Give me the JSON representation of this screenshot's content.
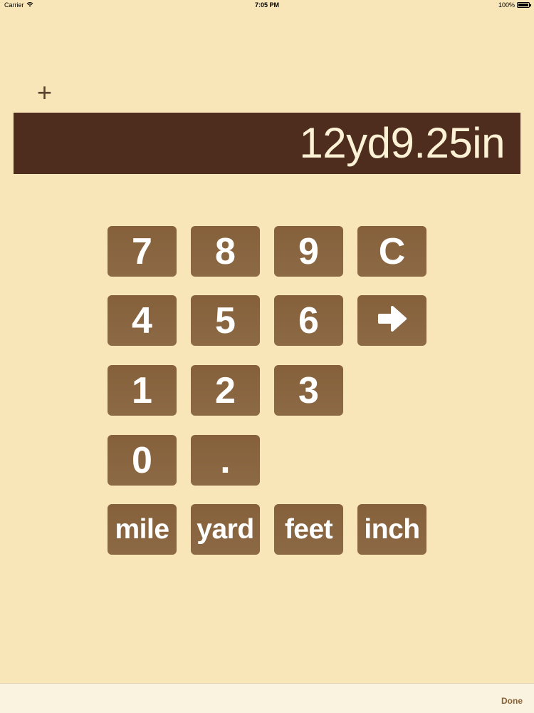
{
  "status_bar": {
    "carrier": "Carrier",
    "time": "7:05 PM",
    "battery": "100%"
  },
  "calculator": {
    "operator": "+",
    "display": "12yd9.25in"
  },
  "keypad": {
    "k7": "7",
    "k8": "8",
    "k9": "9",
    "clear": "C",
    "k4": "4",
    "k5": "5",
    "k6": "6",
    "k1": "1",
    "k2": "2",
    "k3": "3",
    "k0": "0",
    "dot": ".",
    "mile": "mile",
    "yard": "yard",
    "feet": "feet",
    "inch": "inch",
    "enter_icon": "right-arrow-icon"
  },
  "toolbar": {
    "done_label": "Done"
  },
  "colors": {
    "background": "#f8e6b8",
    "display_bg": "#4e2d1e",
    "key_bg": "#8a6641",
    "accent": "#8a6136"
  }
}
